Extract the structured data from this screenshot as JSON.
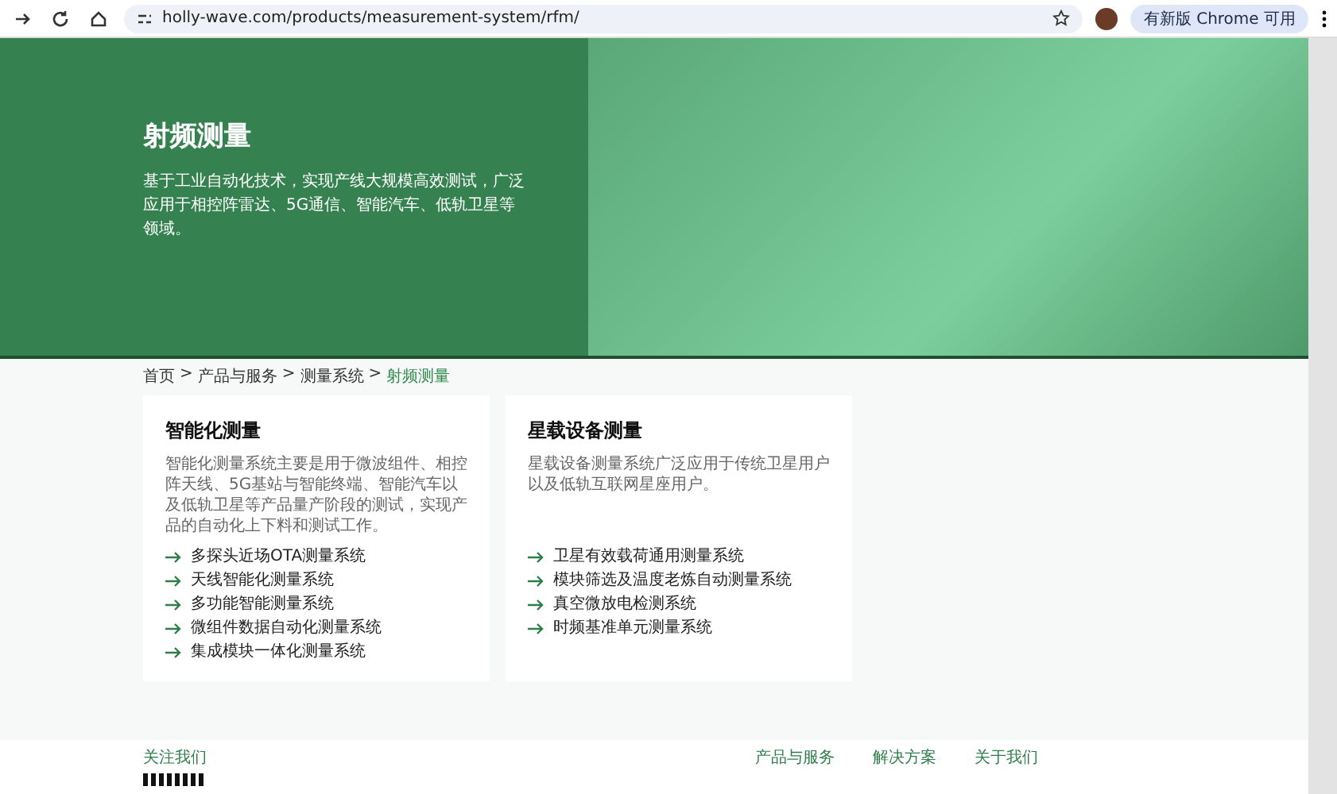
{
  "browser": {
    "url": "holly-wave.com/products/measurement-system/rfm/",
    "update_button": "有新版 Chrome 可用"
  },
  "hero": {
    "title": "射频测量",
    "description": "基于工业自动化技术，实现产线大规模高效测试，广泛应用于相控阵雷达、5G通信、智能汽车、低轨卫星等领域。"
  },
  "breadcrumb_separator": ">",
  "breadcrumb": [
    {
      "label": "首页",
      "selected": false
    },
    {
      "label": "产品与服务",
      "selected": false
    },
    {
      "label": "测量系统",
      "selected": false
    },
    {
      "label": "射频测量",
      "selected": true
    }
  ],
  "cards": [
    {
      "title": "智能化测量",
      "description": "智能化测量系统主要是用于微波组件、相控阵天线、5G基站与智能终端、智能汽车以及低轨卫星等产品量产阶段的测试，实现产品的自动化上下料和测试工作。",
      "items": [
        "多探头近场OTA测量系统",
        "天线智能化测量系统",
        "多功能智能测量系统",
        "微组件数据自动化测量系统",
        "集成模块一体化测量系统"
      ]
    },
    {
      "title": "星载设备测量",
      "description": "星载设备测量系统广泛应用于传统卫星用户以及低轨互联网星座用户。",
      "items": [
        "卫星有效载荷通用测量系统",
        "模块筛选及温度老炼自动测量系统",
        "真空微放电检测系统",
        "时频基准单元测量系统"
      ]
    }
  ],
  "footer": {
    "follow": "关注我们",
    "columns": [
      "产品与服务",
      "解决方案",
      "关于我们"
    ]
  }
}
